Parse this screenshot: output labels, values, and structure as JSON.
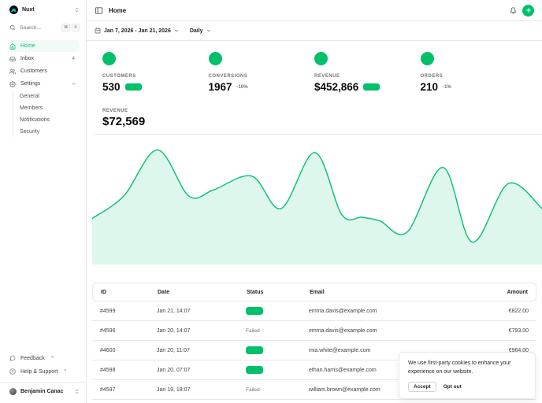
{
  "colors": {
    "primary": "#00c16a",
    "logo_green": "#00dc82",
    "area_fill": "rgba(0,193,106,0.13)",
    "border": "#e5e7eb"
  },
  "sidebar": {
    "team": {
      "name": "Nuxt"
    },
    "search": {
      "label": "Search...",
      "kbd": [
        "⌘",
        "K"
      ]
    },
    "nav": [
      {
        "label": "Home",
        "icon": "home-icon",
        "active": true
      },
      {
        "label": "Inbox",
        "icon": "inbox-icon",
        "badge": "4"
      },
      {
        "label": "Customers",
        "icon": "users-icon"
      },
      {
        "label": "Settings",
        "icon": "gear-icon",
        "expanded": true
      }
    ],
    "settings_children": [
      "General",
      "Members",
      "Notifications",
      "Security"
    ],
    "footer": [
      {
        "label": "Feedback",
        "icon": "chat-icon",
        "external": true
      },
      {
        "label": "Help & Support",
        "icon": "help-icon",
        "external": true
      }
    ],
    "user": {
      "name": "Benjamin Canac"
    }
  },
  "header": {
    "title": "Home"
  },
  "toolbar": {
    "date_range": "Jan 7, 2026 - Jan 21, 2026",
    "granularity": "Daily"
  },
  "stats": [
    {
      "label": "CUSTOMERS",
      "value": "530",
      "delta": {
        "type": "pill"
      }
    },
    {
      "label": "CONVERSIONS",
      "value": "1967",
      "delta": {
        "type": "text",
        "value": "-10%"
      }
    },
    {
      "label": "REVENUE",
      "value": "$452,866",
      "delta": {
        "type": "pill"
      }
    },
    {
      "label": "ORDERS",
      "value": "210",
      "delta": {
        "type": "text",
        "value": "-1%"
      }
    }
  ],
  "chart_data": {
    "type": "area",
    "title": "Revenue",
    "label": "REVENUE",
    "total_value": "$72,569",
    "x_range": [
      "Jan 7, 2026",
      "Jan 21, 2026"
    ],
    "granularity": "Daily",
    "grid": false,
    "axes_visible": false,
    "ylim": [
      0,
      100
    ],
    "series": [
      {
        "name": "Revenue",
        "points": [
          [
            0,
            37
          ],
          [
            7,
            55
          ],
          [
            14.5,
            92
          ],
          [
            21.5,
            55
          ],
          [
            27,
            60
          ],
          [
            35.5,
            71
          ],
          [
            42,
            45
          ],
          [
            49.5,
            90
          ],
          [
            55.5,
            40
          ],
          [
            60,
            38
          ],
          [
            64,
            35
          ],
          [
            70,
            26
          ],
          [
            78,
            78
          ],
          [
            84.5,
            18
          ],
          [
            92.5,
            65
          ],
          [
            100,
            45
          ]
        ]
      }
    ]
  },
  "table": {
    "columns": [
      "ID",
      "Date",
      "Status",
      "Email",
      "Amount"
    ],
    "rows": [
      {
        "id": "#4599",
        "date": "Jan 21, 14:07",
        "status": "paid",
        "status_label": "",
        "email": "emma.davis@example.com",
        "amount": "€822.00"
      },
      {
        "id": "#4596",
        "date": "Jan 20, 14:07",
        "status": "failed",
        "status_label": "Failed",
        "email": "emma.davis@example.com",
        "amount": "€793.00"
      },
      {
        "id": "#4600",
        "date": "Jan 20, 11:07",
        "status": "paid",
        "status_label": "",
        "email": "mia.white@example.com",
        "amount": "€964.00"
      },
      {
        "id": "#4598",
        "date": "Jan 20, 07:07",
        "status": "paid",
        "status_label": "",
        "email": "ethan.harris@example.com",
        "amount": ""
      },
      {
        "id": "#4597",
        "date": "Jan 19, 18:07",
        "status": "failed",
        "status_label": "Failed",
        "email": "william.brown@example.com",
        "amount": ""
      }
    ]
  },
  "cookie_banner": {
    "message": "We use first-party cookies to enhance your experience on our website.",
    "accept_label": "Accept",
    "optout_label": "Opt out"
  }
}
